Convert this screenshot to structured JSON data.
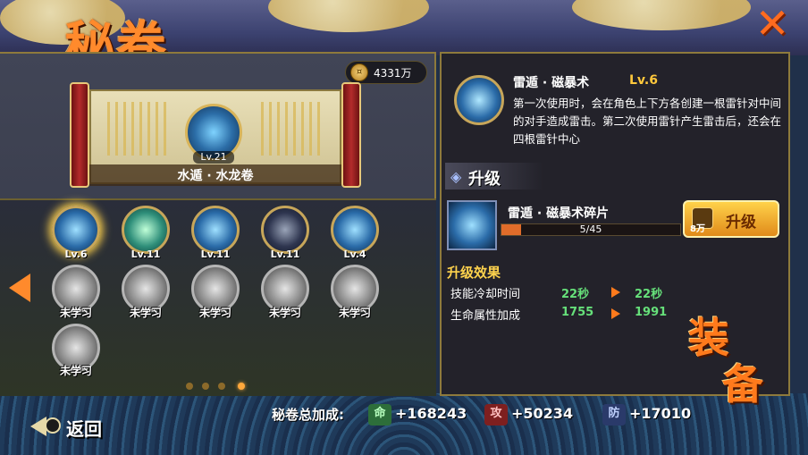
{
  "header": {
    "title": "秘卷",
    "coins": "4331万",
    "close_icon": "close-icon"
  },
  "scroll": {
    "skill_level": "Lv.21",
    "label": "水遁 · 水龙卷"
  },
  "skills": [
    {
      "level": "Lv.6",
      "style": "learned",
      "selected": true
    },
    {
      "level": "Lv.11",
      "style": "green",
      "selected": false
    },
    {
      "level": "Lv.11",
      "style": "learned",
      "selected": false
    },
    {
      "level": "Lv.11",
      "style": "dark",
      "selected": false
    },
    {
      "level": "Lv.4",
      "style": "learned",
      "selected": false
    },
    {
      "locked_label": "未学习"
    },
    {
      "locked_label": "未学习"
    },
    {
      "locked_label": "未学习"
    },
    {
      "locked_label": "未学习"
    },
    {
      "locked_label": "未学习"
    },
    {
      "locked_label": "未学习"
    }
  ],
  "pagination": {
    "total": 4,
    "active": 3
  },
  "detail": {
    "name": "雷遁 · 磁暴术",
    "level": "Lv.6",
    "description": "第一次使用时，会在角色上下方各创建一根雷针对中间的对手造成雷击。第二次使用雷针产生雷击后，还会在四根雷针中心"
  },
  "upgrade": {
    "header": "升级",
    "fragment_name": "雷遁 · 磁暴术碎片",
    "fragment_count": "5/45",
    "fragment_progress": 0.111,
    "cost": "8万",
    "button_label": "升级"
  },
  "effects": {
    "title": "升级效果",
    "rows": [
      {
        "label": "技能冷却时间",
        "from": "22秒",
        "to": "22秒"
      },
      {
        "label": "生命属性加成",
        "from": "1755",
        "to": "1991"
      }
    ]
  },
  "equip_stamp": {
    "line1": "装",
    "line2": "备"
  },
  "footer": {
    "back_label": "返回",
    "bonus_label": "秘卷总加成:",
    "stats": [
      {
        "icon": "命",
        "value": "+168243"
      },
      {
        "icon": "攻",
        "value": "+50234"
      },
      {
        "icon": "防",
        "value": "+17010"
      }
    ]
  },
  "colors": {
    "accent": "#ff8a2c",
    "gold": "#ffd34d",
    "stat_green": "#66e07a",
    "progress": "#e06c2a"
  }
}
